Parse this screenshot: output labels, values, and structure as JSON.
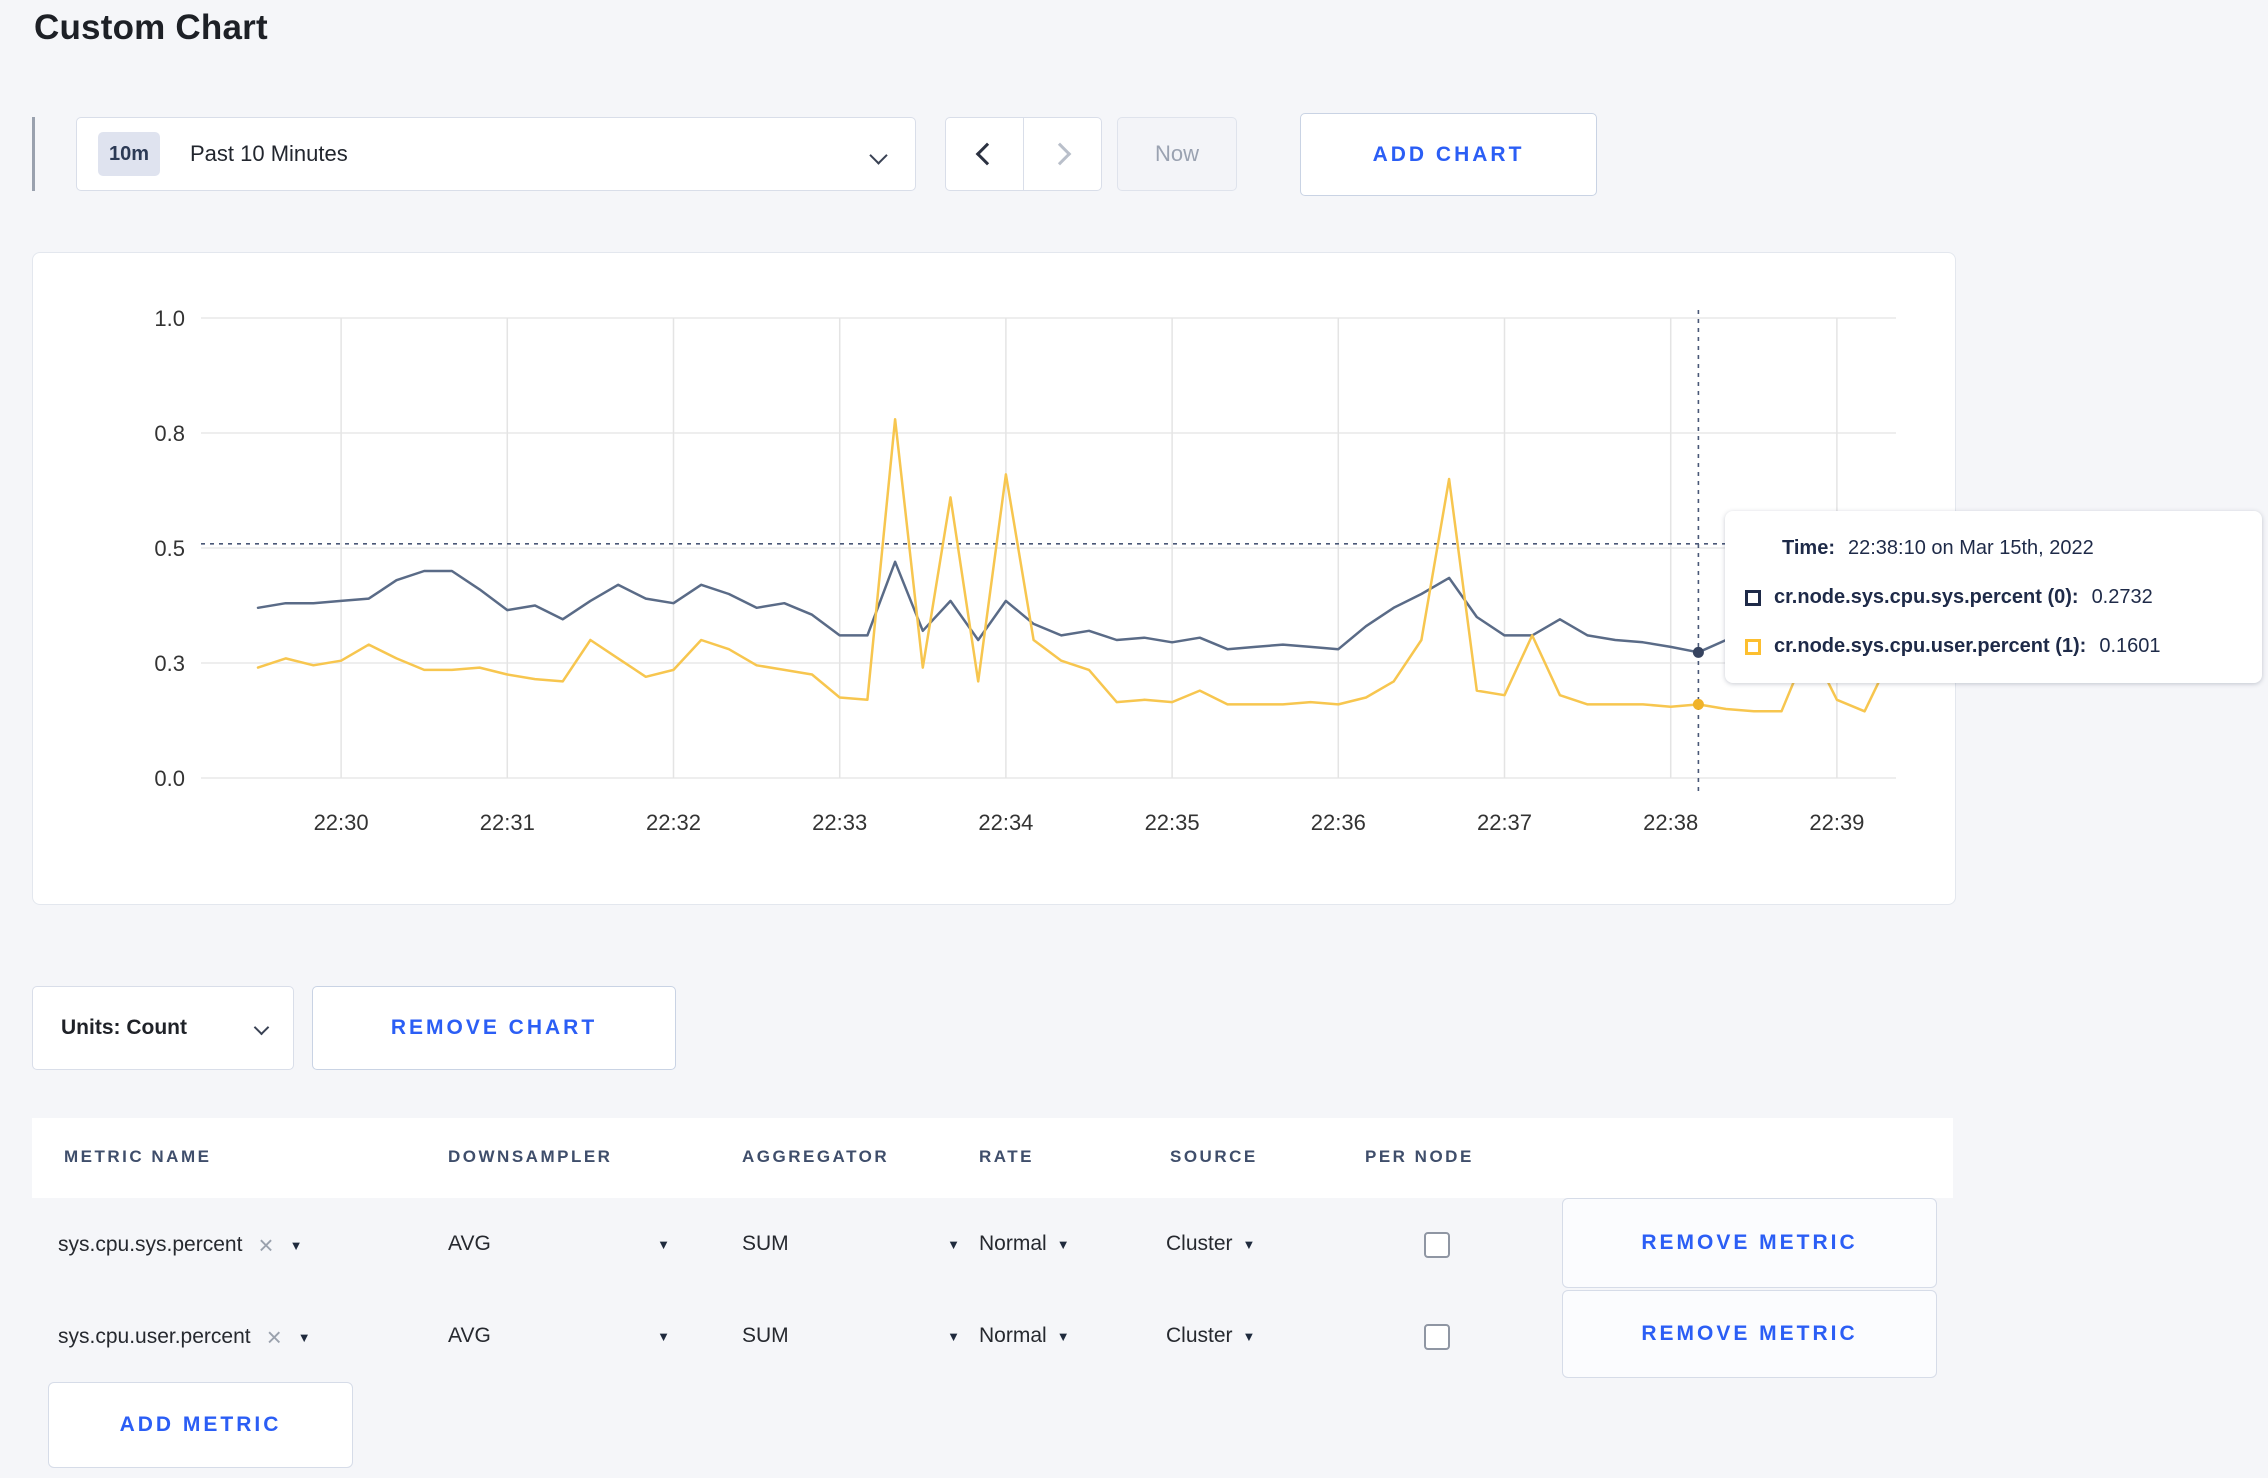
{
  "page": {
    "title": "Custom Chart"
  },
  "toolbar": {
    "range_badge": "10m",
    "range_label": "Past 10 Minutes",
    "now_label": "Now",
    "add_chart_label": "ADD CHART"
  },
  "chart_footer": {
    "units_label": "Units: Count",
    "remove_chart_label": "REMOVE CHART"
  },
  "tooltip": {
    "time_label": "Time:",
    "time_value": "22:38:10 on Mar 15th, 2022",
    "series": [
      {
        "label": "cr.node.sys.cpu.sys.percent (0):",
        "value": "0.2732",
        "color": "#1e2a48"
      },
      {
        "label": "cr.node.sys.cpu.user.percent (1):",
        "value": "0.1601",
        "color": "#fdbf2f"
      }
    ]
  },
  "metrics_table": {
    "headers": [
      "METRIC NAME",
      "DOWNSAMPLER",
      "AGGREGATOR",
      "RATE",
      "SOURCE",
      "PER NODE"
    ],
    "rows": [
      {
        "metric": "sys.cpu.sys.percent",
        "downsampler": "AVG",
        "aggregator": "SUM",
        "rate": "Normal",
        "source": "Cluster",
        "per_node_checked": false,
        "remove_label": "REMOVE METRIC"
      },
      {
        "metric": "sys.cpu.user.percent",
        "downsampler": "AVG",
        "aggregator": "SUM",
        "rate": "Normal",
        "source": "Cluster",
        "per_node_checked": false,
        "remove_label": "REMOVE METRIC"
      }
    ],
    "add_metric_label": "ADD METRIC"
  },
  "chart_data": {
    "type": "line",
    "title": "",
    "xlabel": "",
    "ylabel": "",
    "ylim": [
      0,
      1
    ],
    "grid": true,
    "x_start": "22:29:30",
    "x_interval_seconds": 10,
    "x_tick_labels": [
      "22:30",
      "22:31",
      "22:32",
      "22:33",
      "22:34",
      "22:35",
      "22:36",
      "22:37",
      "22:38",
      "22:39"
    ],
    "x_tick_indices": [
      3,
      9,
      15,
      21,
      27,
      33,
      39,
      45,
      51,
      57
    ],
    "y_tick_values": [
      0,
      0.25,
      0.5,
      0.75,
      1.0
    ],
    "y_tick_labels": [
      "0.0",
      "0.3",
      "0.5",
      "0.8",
      "1.0"
    ],
    "series": [
      {
        "name": "cr.node.sys.cpu.sys.percent",
        "color": "#5a6b87",
        "dot_color": "#36435f",
        "values": [
          0.37,
          0.38,
          0.38,
          0.385,
          0.39,
          0.43,
          0.45,
          0.45,
          0.41,
          0.365,
          0.375,
          0.345,
          0.385,
          0.42,
          0.39,
          0.38,
          0.42,
          0.4,
          0.37,
          0.38,
          0.355,
          0.31,
          0.31,
          0.47,
          0.32,
          0.385,
          0.3,
          0.385,
          0.335,
          0.31,
          0.32,
          0.3,
          0.305,
          0.295,
          0.305,
          0.28,
          0.285,
          0.29,
          0.285,
          0.28,
          0.33,
          0.37,
          0.4,
          0.435,
          0.35,
          0.31,
          0.31,
          0.345,
          0.31,
          0.3,
          0.295,
          0.285,
          0.2732,
          0.3,
          0.28,
          0.285,
          0.3,
          0.31,
          0.3,
          0.33
        ]
      },
      {
        "name": "cr.node.sys.cpu.user.percent",
        "color": "#f7c64f",
        "dot_color": "#f0b32a",
        "values": [
          0.24,
          0.26,
          0.245,
          0.255,
          0.29,
          0.26,
          0.235,
          0.235,
          0.24,
          0.225,
          0.215,
          0.21,
          0.3,
          0.26,
          0.22,
          0.235,
          0.3,
          0.28,
          0.245,
          0.235,
          0.225,
          0.175,
          0.17,
          0.78,
          0.24,
          0.61,
          0.21,
          0.66,
          0.3,
          0.255,
          0.235,
          0.165,
          0.17,
          0.165,
          0.19,
          0.16,
          0.16,
          0.16,
          0.165,
          0.16,
          0.175,
          0.21,
          0.3,
          0.65,
          0.19,
          0.18,
          0.31,
          0.18,
          0.16,
          0.16,
          0.16,
          0.155,
          0.1601,
          0.15,
          0.145,
          0.145,
          0.29,
          0.17,
          0.145,
          0.27
        ]
      }
    ],
    "crosshair": {
      "index": 52,
      "time": "22:38:10",
      "y_line_value": 0.509
    }
  }
}
